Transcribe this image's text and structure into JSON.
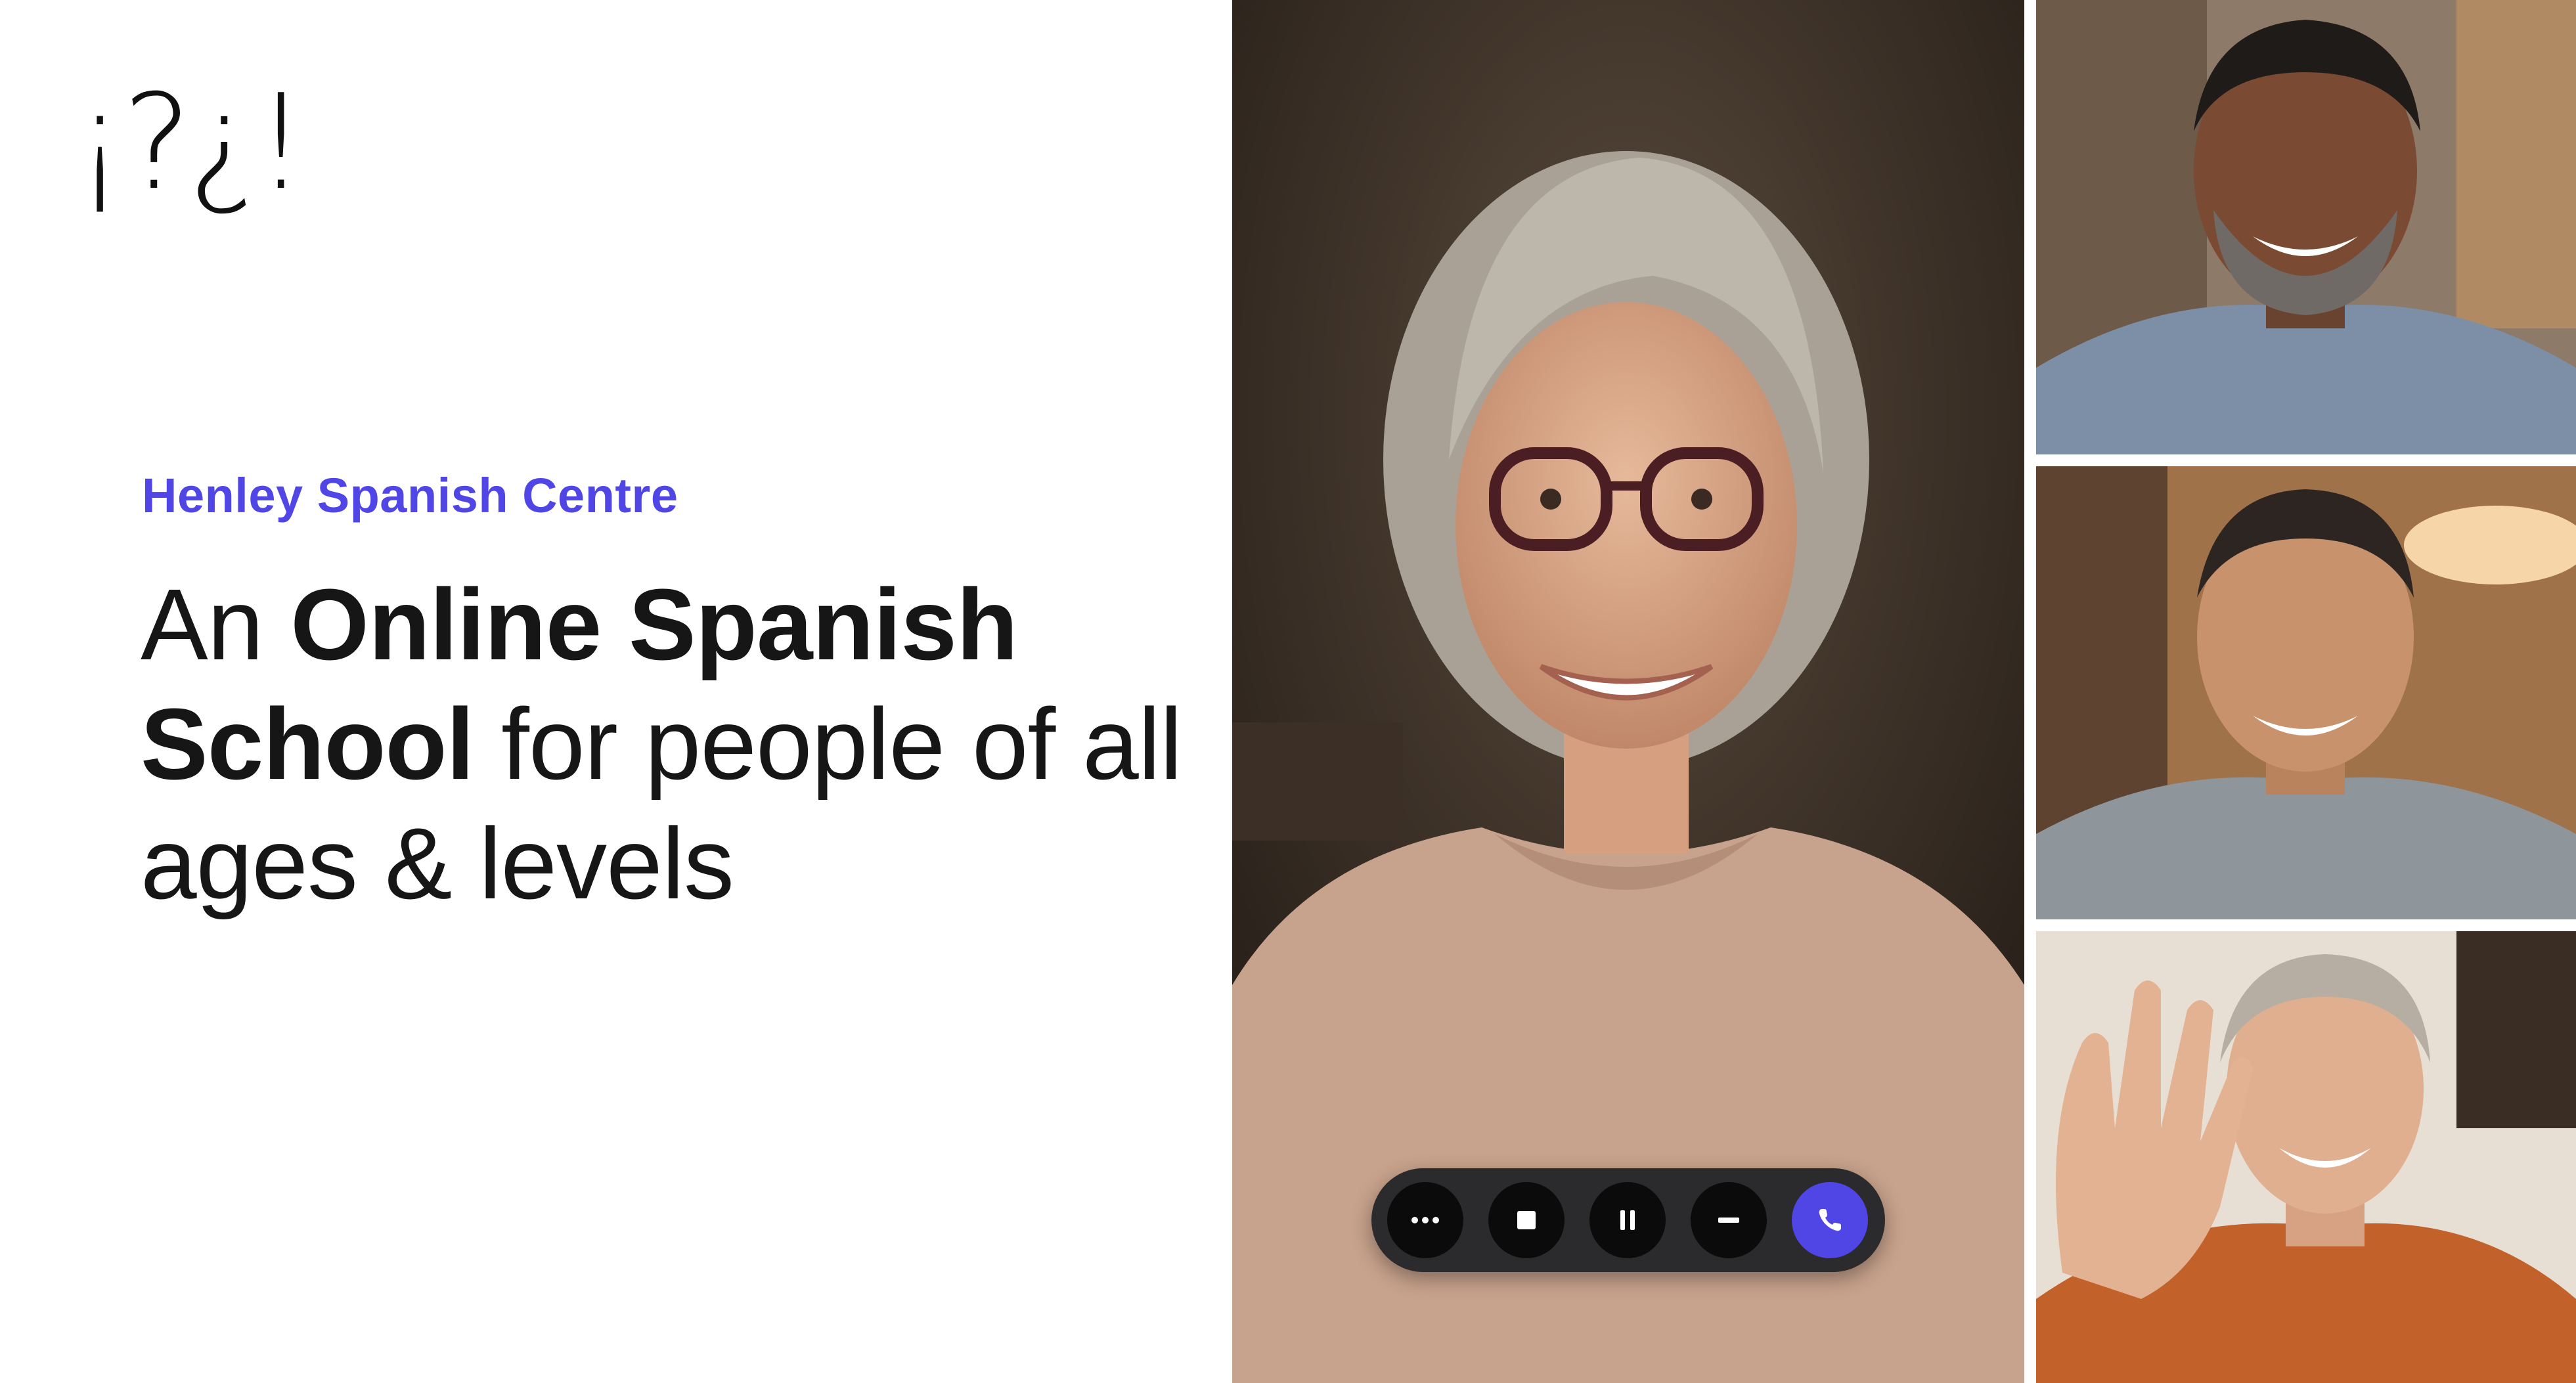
{
  "logo": {
    "text": "¡?¿!"
  },
  "hero": {
    "brand": "Henley Spanish Centre",
    "headline_part1": "An ",
    "headline_bold1": "Online Spanish School",
    "headline_part2": " for people of all ages & levels"
  },
  "colors": {
    "accent": "#4f46e5",
    "text": "#161616",
    "controls_bar": "#2b2b2d",
    "control_button": "#0b0b0c"
  },
  "call": {
    "participants": [
      {
        "role": "main-speaker",
        "description_icon": "woman-with-glasses-avatar"
      },
      {
        "role": "participant",
        "description_icon": "bearded-man-avatar"
      },
      {
        "role": "participant",
        "description_icon": "smiling-man-avatar"
      },
      {
        "role": "participant",
        "description_icon": "waving-woman-avatar"
      }
    ],
    "controls": [
      {
        "icon": "more-icon"
      },
      {
        "icon": "stop-icon"
      },
      {
        "icon": "pause-icon"
      },
      {
        "icon": "minimize-icon"
      },
      {
        "icon": "phone-icon"
      }
    ]
  }
}
